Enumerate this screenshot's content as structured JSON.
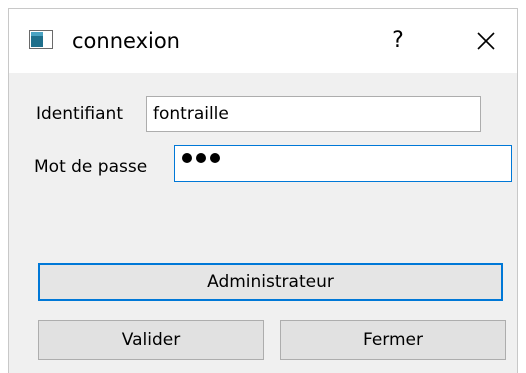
{
  "window": {
    "title": "connexion",
    "help_label": "?",
    "app_icon": "app-window-icon",
    "close_icon": "close-icon"
  },
  "form": {
    "identifiant_label": "Identifiant",
    "identifiant_value": "fontraille",
    "password_label": "Mot de passe",
    "password_masked": "•••"
  },
  "buttons": {
    "admin_label": "Administrateur",
    "valider_label": "Valider",
    "fermer_label": "Fermer"
  },
  "colors": {
    "accent": "#0078d7",
    "button_bg": "#e1e1e1",
    "dialog_bg": "#f0f0f0"
  }
}
